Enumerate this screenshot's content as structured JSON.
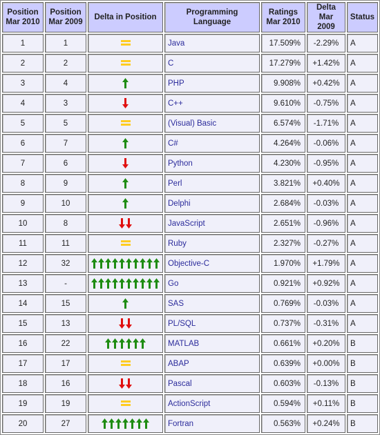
{
  "headers": [
    "Position Mar 2010",
    "Position Mar 2009",
    "Delta in Position",
    "Programming Language",
    "Ratings Mar 2010",
    "Delta Mar 2009",
    "Status"
  ],
  "colors": {
    "header_bg": "#ccccff",
    "cell_bg": "#f0f0fa",
    "link": "#2b2b9b",
    "up": "#1e8c12",
    "down": "#e01010",
    "same": "#ffcc22"
  },
  "rows": [
    {
      "pos2010": "1",
      "pos2009": "1",
      "delta": {
        "type": "same",
        "count": 1
      },
      "language": "Java",
      "rating": "17.509%",
      "change": "-2.29%",
      "status": "A"
    },
    {
      "pos2010": "2",
      "pos2009": "2",
      "delta": {
        "type": "same",
        "count": 1
      },
      "language": "C",
      "rating": "17.279%",
      "change": "+1.42%",
      "status": "A"
    },
    {
      "pos2010": "3",
      "pos2009": "4",
      "delta": {
        "type": "up",
        "count": 1
      },
      "language": "PHP",
      "rating": "9.908%",
      "change": "+0.42%",
      "status": "A"
    },
    {
      "pos2010": "4",
      "pos2009": "3",
      "delta": {
        "type": "down",
        "count": 1
      },
      "language": "C++",
      "rating": "9.610%",
      "change": "-0.75%",
      "status": "A"
    },
    {
      "pos2010": "5",
      "pos2009": "5",
      "delta": {
        "type": "same",
        "count": 1
      },
      "language": "(Visual) Basic",
      "rating": "6.574%",
      "change": "-1.71%",
      "status": "A"
    },
    {
      "pos2010": "6",
      "pos2009": "7",
      "delta": {
        "type": "up",
        "count": 1
      },
      "language": "C#",
      "rating": "4.264%",
      "change": "-0.06%",
      "status": "A"
    },
    {
      "pos2010": "7",
      "pos2009": "6",
      "delta": {
        "type": "down",
        "count": 1
      },
      "language": "Python",
      "rating": "4.230%",
      "change": "-0.95%",
      "status": "A"
    },
    {
      "pos2010": "8",
      "pos2009": "9",
      "delta": {
        "type": "up",
        "count": 1
      },
      "language": "Perl",
      "rating": "3.821%",
      "change": "+0.40%",
      "status": "A"
    },
    {
      "pos2010": "9",
      "pos2009": "10",
      "delta": {
        "type": "up",
        "count": 1
      },
      "language": "Delphi",
      "rating": "2.684%",
      "change": "-0.03%",
      "status": "A"
    },
    {
      "pos2010": "10",
      "pos2009": "8",
      "delta": {
        "type": "down",
        "count": 2
      },
      "language": "JavaScript",
      "rating": "2.651%",
      "change": "-0.96%",
      "status": "A"
    },
    {
      "pos2010": "11",
      "pos2009": "11",
      "delta": {
        "type": "same",
        "count": 1
      },
      "language": "Ruby",
      "rating": "2.327%",
      "change": "-0.27%",
      "status": "A"
    },
    {
      "pos2010": "12",
      "pos2009": "32",
      "delta": {
        "type": "up",
        "count": 10
      },
      "language": "Objective-C",
      "rating": "1.970%",
      "change": "+1.79%",
      "status": "A"
    },
    {
      "pos2010": "13",
      "pos2009": "-",
      "delta": {
        "type": "up",
        "count": 10
      },
      "language": "Go",
      "rating": "0.921%",
      "change": "+0.92%",
      "status": "A"
    },
    {
      "pos2010": "14",
      "pos2009": "15",
      "delta": {
        "type": "up",
        "count": 1
      },
      "language": "SAS",
      "rating": "0.769%",
      "change": "-0.03%",
      "status": "A"
    },
    {
      "pos2010": "15",
      "pos2009": "13",
      "delta": {
        "type": "down",
        "count": 2
      },
      "language": "PL/SQL",
      "rating": "0.737%",
      "change": "-0.31%",
      "status": "A"
    },
    {
      "pos2010": "16",
      "pos2009": "22",
      "delta": {
        "type": "up",
        "count": 6
      },
      "language": "MATLAB",
      "rating": "0.661%",
      "change": "+0.20%",
      "status": "B"
    },
    {
      "pos2010": "17",
      "pos2009": "17",
      "delta": {
        "type": "same",
        "count": 1
      },
      "language": "ABAP",
      "rating": "0.639%",
      "change": "+0.00%",
      "status": "B"
    },
    {
      "pos2010": "18",
      "pos2009": "16",
      "delta": {
        "type": "down",
        "count": 2
      },
      "language": "Pascal",
      "rating": "0.603%",
      "change": "-0.13%",
      "status": "B"
    },
    {
      "pos2010": "19",
      "pos2009": "19",
      "delta": {
        "type": "same",
        "count": 1
      },
      "language": "ActionScript",
      "rating": "0.594%",
      "change": "+0.11%",
      "status": "B"
    },
    {
      "pos2010": "20",
      "pos2009": "27",
      "delta": {
        "type": "up",
        "count": 7
      },
      "language": "Fortran",
      "rating": "0.563%",
      "change": "+0.24%",
      "status": "B"
    }
  ]
}
